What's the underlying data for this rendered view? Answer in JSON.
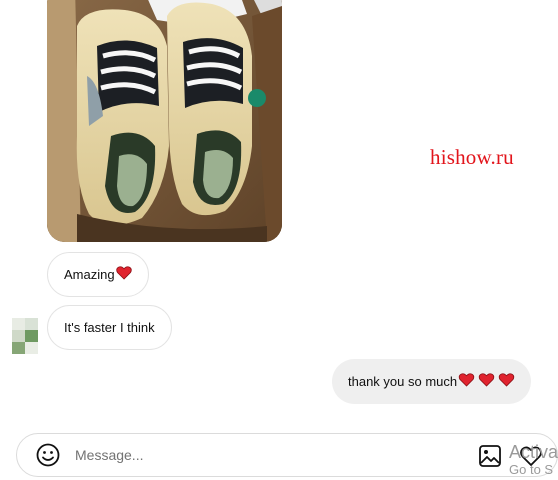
{
  "watermark": {
    "text": "hishow.ru",
    "color": "#e2141b"
  },
  "photo": {
    "alt": "Shoes in a box"
  },
  "messages": [
    {
      "direction": "incoming",
      "text": "Amazing",
      "hearts": 1
    },
    {
      "direction": "incoming",
      "text": "It's faster I think",
      "hearts": 0
    },
    {
      "direction": "outgoing",
      "text": "thank you so much",
      "hearts": 3
    }
  ],
  "composer": {
    "placeholder": "Message...",
    "emoji_icon": "emoji-icon",
    "image_icon": "image-icon",
    "like_icon": "heart-icon"
  },
  "activation": {
    "line1": "Activa",
    "line2": "Go to S"
  },
  "colors": {
    "heart": "#e0232e",
    "bubble_out": "#efefef",
    "border": "#dbdbdb"
  }
}
